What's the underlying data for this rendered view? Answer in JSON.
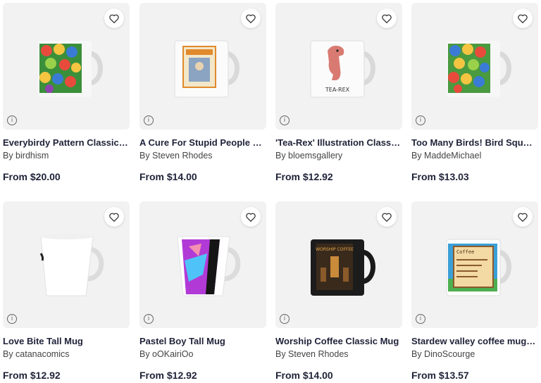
{
  "products": [
    {
      "title": "Everybirdy Pattern Classic Mug",
      "artist": "By birdhism",
      "price": "From $20.00",
      "mug": "birds-classic"
    },
    {
      "title": "A Cure For Stupid People Classic Mug",
      "artist": "By Steven Rhodes",
      "price": "From $14.00",
      "mug": "stupid-people"
    },
    {
      "title": "'Tea-Rex' Illustration Classic Mug",
      "artist": "By bloemsgallery",
      "price": "From $12.92",
      "mug": "tea-rex",
      "mug_text": "TEA-REX"
    },
    {
      "title": "Too Many Birds! Bird Squad Classic Mug",
      "artist": "By MaddeMichael",
      "price": "From $13.03",
      "mug": "birds-classic"
    },
    {
      "title": "Love Bite Tall Mug",
      "artist": "By catanacomics",
      "price": "From $12.92",
      "mug": "white-tall"
    },
    {
      "title": "Pastel Boy Tall Mug",
      "artist": "By oOKairiOo",
      "price": "From $12.92",
      "mug": "pastel-tall"
    },
    {
      "title": "Worship Coffee Classic Mug",
      "artist": "By Steven Rhodes",
      "price": "From $14.00",
      "mug": "black-coffee",
      "mug_text": "WORSHIP COFFEE"
    },
    {
      "title": "Stardew valley coffee mug Classic Mug",
      "artist": "By DinoScourge",
      "price": "From $13.57",
      "mug": "stardew",
      "mug_text": "Coffee"
    }
  ],
  "icons": {
    "favorite": "heart-outline-icon",
    "info": "info-circle-icon"
  },
  "colors": {
    "text_dark": "#1f2238",
    "thumb_bg": "#f2f2f2"
  }
}
